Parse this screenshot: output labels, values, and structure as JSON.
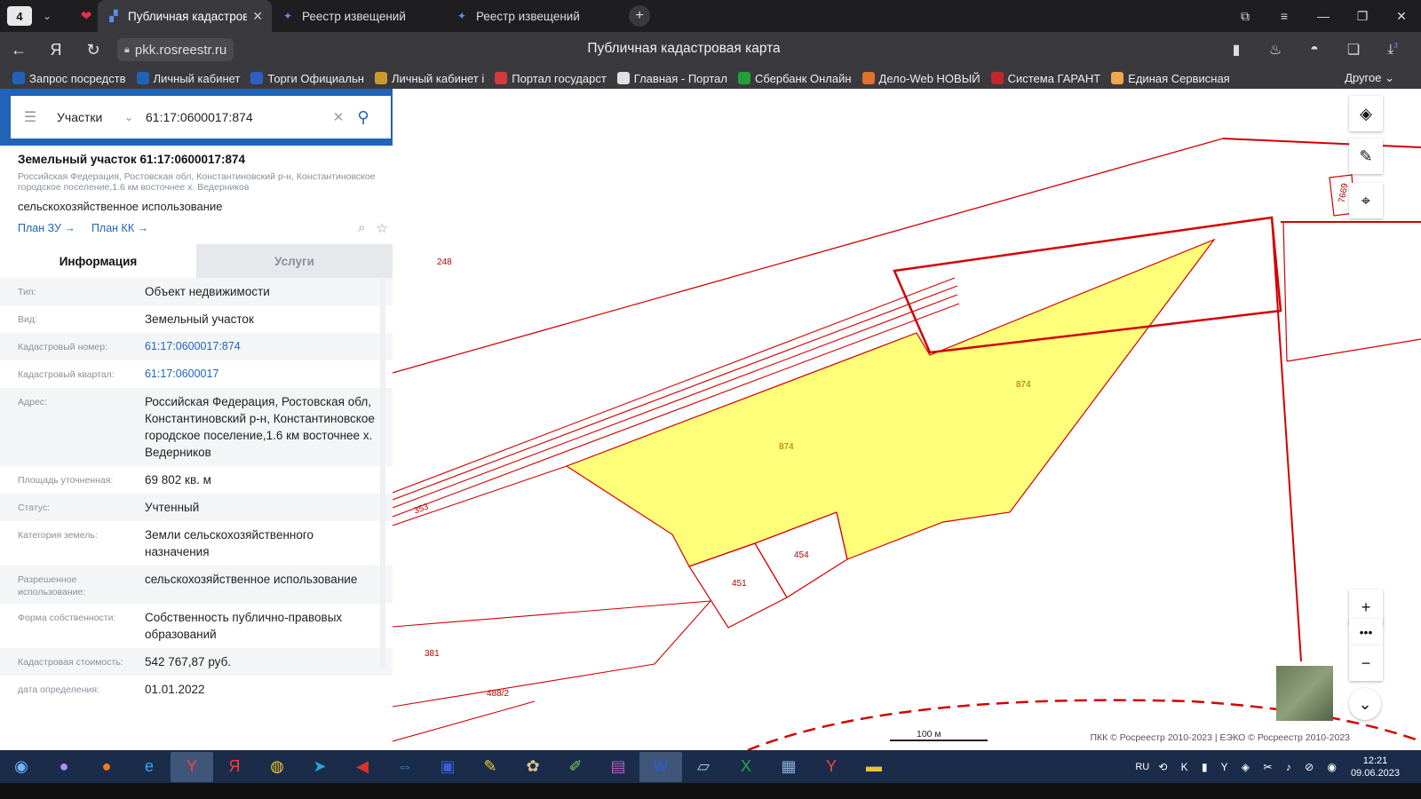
{
  "browser": {
    "tab_count": "4",
    "tabs": [
      {
        "label": "Публичная кадастрова",
        "active": true
      },
      {
        "label": "Реестр извещений",
        "active": false
      },
      {
        "label": "Реестр извещений",
        "active": false
      }
    ],
    "url": "pkk.rosreestr.ru",
    "page_title": "Публичная кадастровая карта",
    "download_badge": "3",
    "bookmarks": [
      {
        "label": "Запрос посредств",
        "color": "#1f64b6"
      },
      {
        "label": "Личный кабинет",
        "color": "#1f64b6"
      },
      {
        "label": "Торги Официальн",
        "color": "#2d5fc4"
      },
      {
        "label": "Личный кабинет і",
        "color": "#c99a2e"
      },
      {
        "label": "Портал государст",
        "color": "#d33b3b"
      },
      {
        "label": "Главная - Портал",
        "color": "#e0e0e0"
      },
      {
        "label": "Сбербанк Онлайн",
        "color": "#21a038"
      },
      {
        "label": "Дело-Web НОВЫЙ",
        "color": "#e0702a"
      },
      {
        "label": "Система ГАРАНТ",
        "color": "#c0282d"
      },
      {
        "label": "Единая Сервисная",
        "color": "#f0a64a"
      }
    ],
    "bookmarks_other": "Другое"
  },
  "search": {
    "type": "Участки",
    "query": "61:17:0600017:874"
  },
  "card": {
    "title": "Земельный участок 61:17:0600017:874",
    "address_line": "Российская Федерация, Ростовская обл, Константиновский р-н, Константиновское городское поселение,1.6 км восточнее х. Ведерников",
    "use": "сельскохозяйственное использование",
    "link_plan_zu": "План ЗУ →",
    "link_plan_kk": "План КК →"
  },
  "tabs": {
    "info": "Информация",
    "services": "Услуги"
  },
  "rows": [
    {
      "label": "Тип:",
      "value": "Объект недвижимости"
    },
    {
      "label": "Вид:",
      "value": "Земельный участок"
    },
    {
      "label": "Кадастровый номер:",
      "value": "61:17:0600017:874",
      "link": true
    },
    {
      "label": "Кадастровый квартал:",
      "value": "61:17:0600017",
      "link": true
    },
    {
      "label": "Адрес:",
      "value": "Российская Федерация, Ростовская обл, Константиновский р-н, Константиновское городское поселение,1.6 км восточнее х. Ведерников"
    },
    {
      "label": "Площадь уточненная:",
      "value": "69 802 кв. м"
    },
    {
      "label": "Статус:",
      "value": "Учтенный"
    },
    {
      "label": "Категория земель:",
      "value": "Земли сельскохозяйственного назначения"
    },
    {
      "label": "Разрешенное использование:",
      "value": "сельскохозяйственное использование"
    },
    {
      "label": "Форма собственности:",
      "value": "Собственность публично-правовых образований"
    },
    {
      "label": "Кадастровая стоимость:",
      "value": "542 767,87 руб."
    },
    {
      "label": "дата определения:",
      "value": "01.01.2022"
    }
  ],
  "map": {
    "labels": [
      "248",
      "874",
      "874",
      "353",
      "454",
      "451",
      "381",
      "488/2",
      "7669"
    ],
    "scale": "100 м",
    "attribution": "ПКК © Росреестр 2010-2023 | ЕЭКО © Росреестр 2010-2023",
    "highlight_color": "#ffff7a",
    "boundary_color": "#d40000"
  },
  "taskbar": {
    "lang": "RU",
    "time": "12:21",
    "date": "09.06.2023"
  }
}
